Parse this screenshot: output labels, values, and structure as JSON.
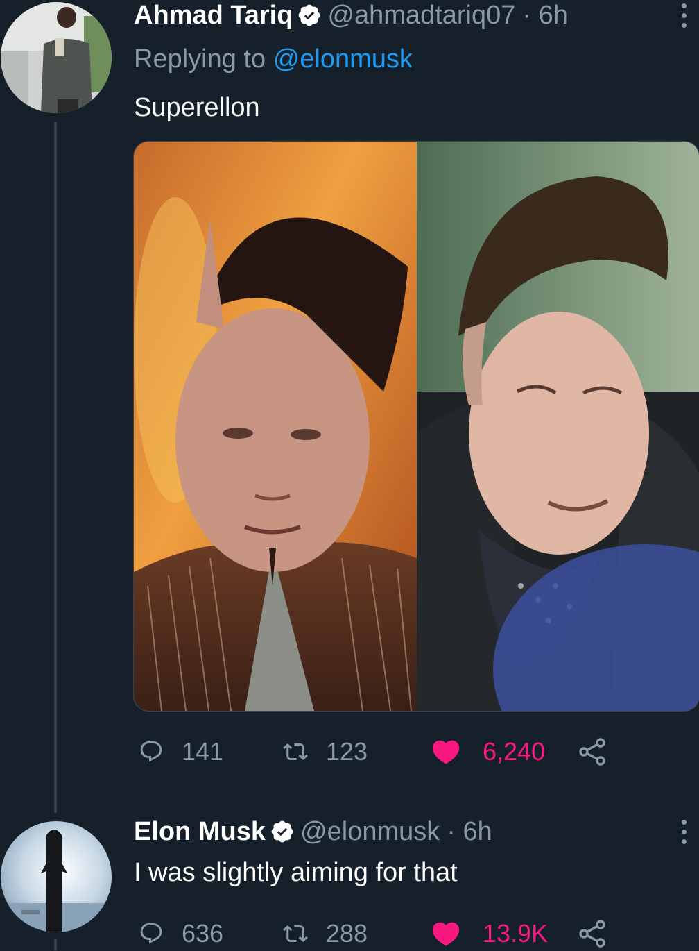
{
  "tweets": [
    {
      "author_name": "Ahmad Tariq",
      "handle": "@ahmadtariq07",
      "time": "· 6h",
      "replying_prefix": "Replying to ",
      "replying_to": "@elonmusk",
      "text": "Superellon",
      "replies": "141",
      "retweets": "123",
      "likes": "6,240"
    },
    {
      "author_name": "Elon Musk",
      "handle": "@elonmusk",
      "time": "· 6h",
      "text": "I was slightly aiming for that",
      "replies": "636",
      "retweets": "288",
      "likes": "13.9K"
    }
  ],
  "colors": {
    "background": "#15202b",
    "secondary_text": "#8b98a5",
    "link": "#1d9bf0",
    "like": "#f91880",
    "verified": "#ffffff"
  },
  "icons": [
    "verified-badge-icon",
    "more-options-icon",
    "reply-icon",
    "retweet-icon",
    "like-heart-icon",
    "share-icon"
  ]
}
